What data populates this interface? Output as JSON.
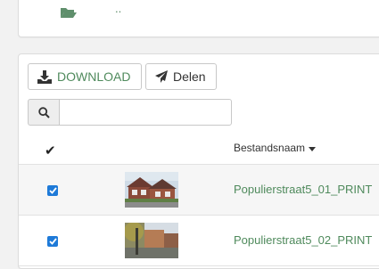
{
  "folder": {
    "icon": "folder-open-icon",
    "parent_link": ".."
  },
  "toolbar": {
    "download_label": "DOWNLOAD",
    "download_icon": "download-icon",
    "share_label": "Delen",
    "share_icon": "paper-plane-icon"
  },
  "search": {
    "icon": "search-icon",
    "value": "",
    "placeholder": ""
  },
  "table": {
    "select_all_icon": "checkmark-icon",
    "columns": {
      "name": "Bestandsnaam",
      "sort_icon": "caret-down-icon"
    },
    "rows": [
      {
        "checked": true,
        "thumbnail": "house-photo-thumbnail",
        "name": "Populierstraat5_01_PRINT"
      },
      {
        "checked": true,
        "thumbnail": "street-photo-thumbnail",
        "name": "Populierstraat5_02_PRINT"
      }
    ]
  },
  "colors": {
    "accent_green": "#4f8a5c",
    "checkbox_blue": "#1e7ad8"
  }
}
